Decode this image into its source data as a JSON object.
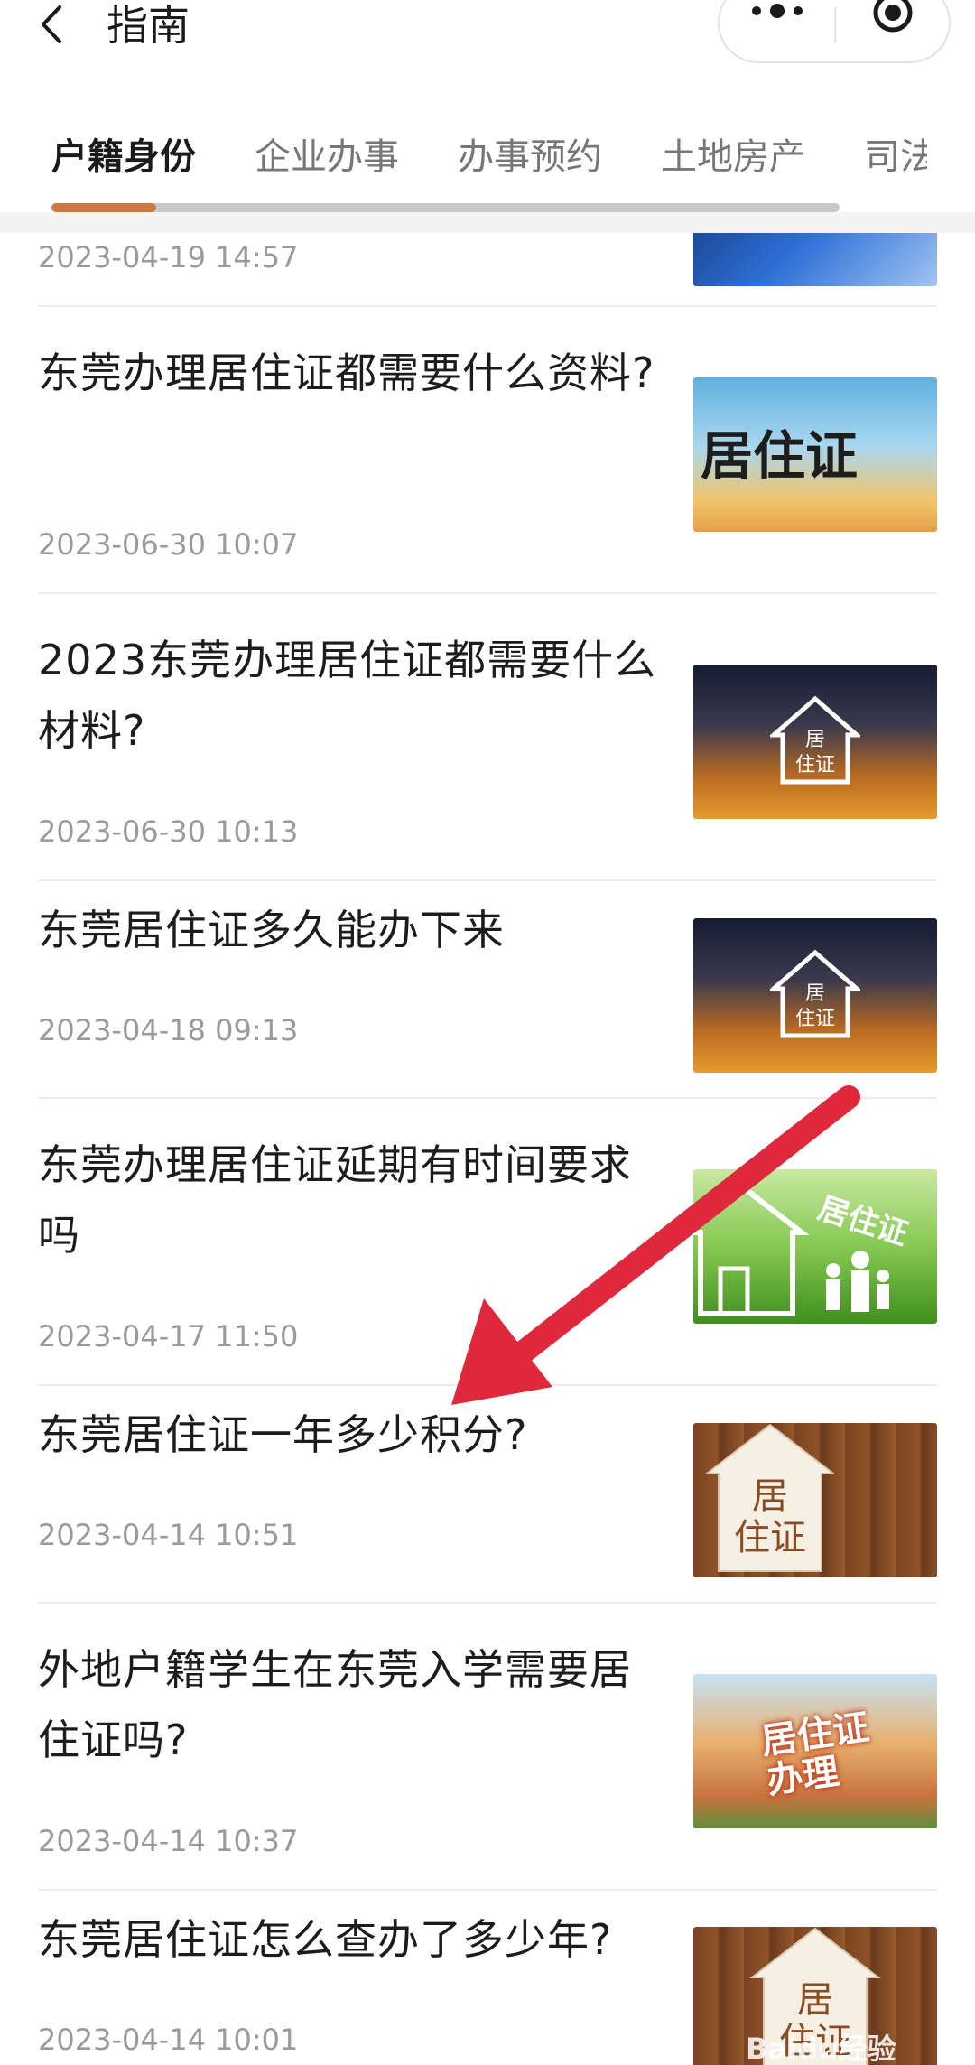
{
  "header": {
    "title": "指南"
  },
  "tabs": [
    {
      "label": "户籍身份",
      "active": true
    },
    {
      "label": "企业办事",
      "active": false
    },
    {
      "label": "办事预约",
      "active": false
    },
    {
      "label": "土地房产",
      "active": false
    },
    {
      "label": "司法",
      "active": false
    }
  ],
  "articles": [
    {
      "title": "",
      "date": "2023-04-19 14:57"
    },
    {
      "title": "东莞办理居住证都需要什么资料?",
      "date": "2023-06-30 10:07",
      "thumb_text": "居住证"
    },
    {
      "title": "2023东莞办理居住证都需要什么材料?",
      "date": "2023-06-30 10:13",
      "thumb_text": "居住证"
    },
    {
      "title": "东莞居住证多久能办下来",
      "date": "2023-04-18 09:13",
      "thumb_text": "居住证"
    },
    {
      "title": "东莞办理居住证延期有时间要求吗",
      "date": "2023-04-17 11:50",
      "thumb_text": "居住证"
    },
    {
      "title": "东莞居住证一年多少积分?",
      "date": "2023-04-14 10:51",
      "thumb_text": "居住证"
    },
    {
      "title": "外地户籍学生在东莞入学需要居住证吗?",
      "date": "2023-04-14 10:37",
      "thumb_text": "居住证办理"
    },
    {
      "title": "东莞居住证怎么查办了多少年?",
      "date": "2023-04-14 10:01",
      "thumb_text": "居住证"
    }
  ],
  "watermark": "Baidu经验",
  "colors": {
    "tab_indicator": "#cc7a44",
    "arrow": "#e0283c"
  },
  "icons": {
    "back": "chevron-left-icon",
    "more": "more-dots-icon",
    "close": "target-circle-icon"
  }
}
